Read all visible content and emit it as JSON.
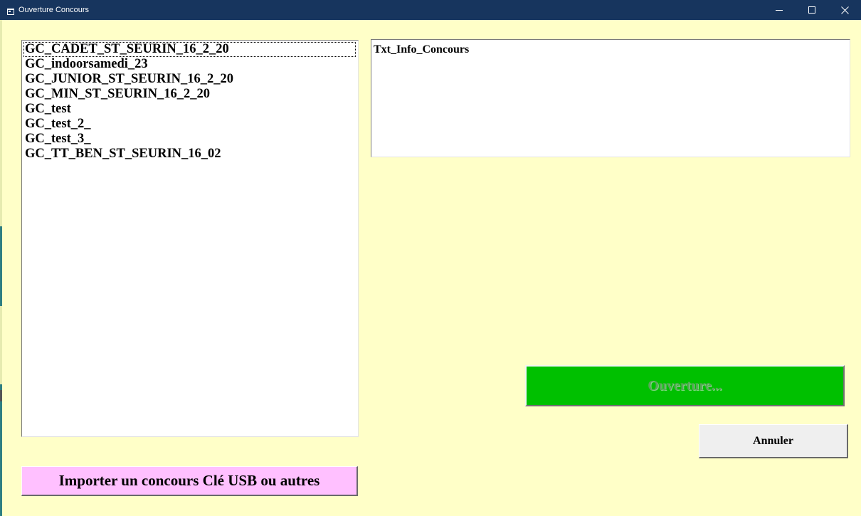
{
  "window": {
    "title": "Ouverture Concours",
    "controls": {
      "minimize_icon": "minimize-icon",
      "maximize_icon": "maximize-icon",
      "close_icon": "close-icon"
    }
  },
  "contest_list": {
    "items": [
      "GC_CADET_ST_SEURIN_16_2_20",
      "GC_indoorsamedi_23",
      "GC_JUNIOR_ST_SEURIN_16_2_20",
      "GC_MIN_ST_SEURIN_16_2_20",
      "GC_test",
      "GC_test_2_",
      "GC_test_3_",
      "GC_TT_BEN_ST_SEURIN_16_02"
    ],
    "focused_index": 0
  },
  "info_box": {
    "text": "Txt_Info_Concours"
  },
  "buttons": {
    "open_label": "Ouverture...",
    "cancel_label": "Annuler",
    "import_label": "Importer un concours Clé USB ou autres"
  },
  "colors": {
    "title_bar": "#17355e",
    "form_background": "#ffffc8",
    "open_button": "#00c000",
    "import_button": "#ffc0ff",
    "cancel_button": "#efefef"
  }
}
